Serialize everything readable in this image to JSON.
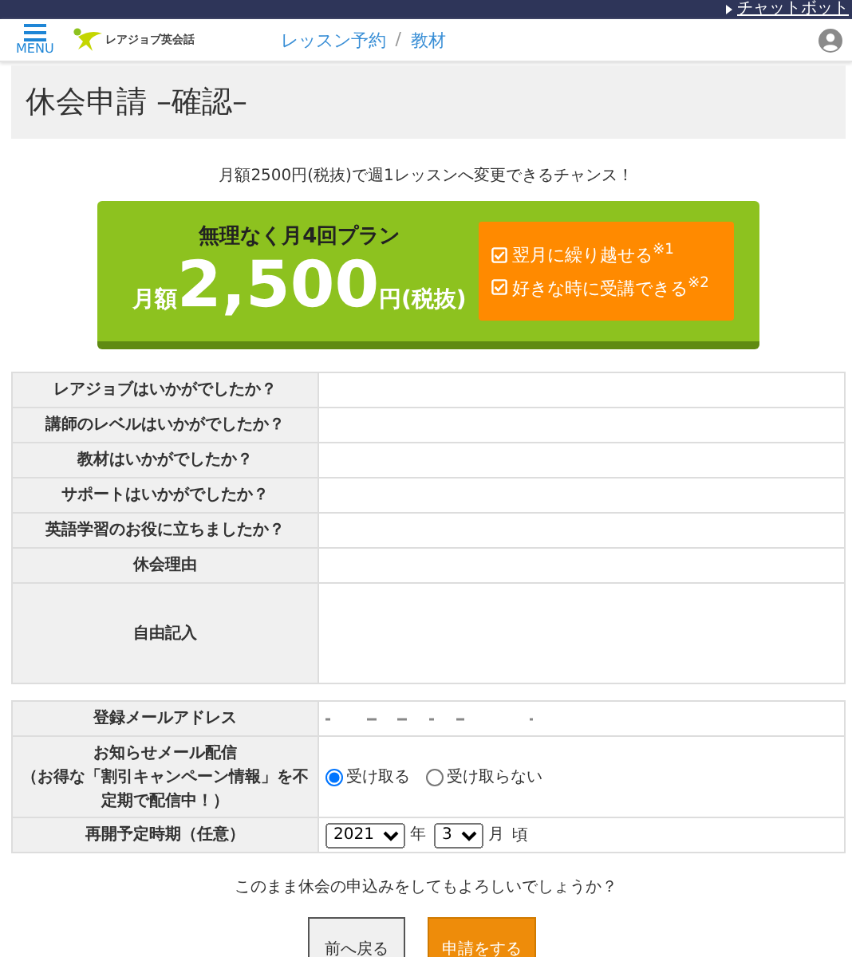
{
  "top_bar": {
    "link": "チャットボット"
  },
  "header": {
    "menu_label": "MENU",
    "logo_text": "レアジョブ英会話",
    "nav": [
      {
        "label": "レッスン予約"
      },
      {
        "label": "教材"
      }
    ],
    "separator": "/"
  },
  "page_title": "休会申請 –確認–",
  "promo": {
    "lead": "月額2500円(税抜)で週1レッスンへ変更できるチャンス！",
    "plan": "無理なく月4回プラン",
    "price_prefix": "月額",
    "price": "2,500",
    "price_suffix": "円(税抜)",
    "features": [
      {
        "text": "翌月に繰り越せる$^{※1}$",
        "checked": true
      },
      {
        "text": "好きな時に受講できる$^{※2}$",
        "checked": true
      }
    ]
  },
  "survey_table": {
    "rows": [
      {
        "label": "レアジョブはいかがでしたか？",
        "kind": "short"
      },
      {
        "label": "講師のレベルはいかがでしたか？",
        "kind": "short"
      },
      {
        "label": "教材はいかがでしたか？",
        "kind": "short"
      },
      {
        "label": "サポートはいかがでしたか？",
        "kind": "short"
      },
      {
        "label": "英語学習のお役に立ちましたか？",
        "kind": "short"
      },
      {
        "label": "休会理由",
        "kind": "short"
      },
      {
        "label": "自由記入",
        "kind": "tall"
      }
    ]
  },
  "account_table": {
    "email_label": "登録メールアドレス",
    "newsletter_label": "お知らせメール配信",
    "newsletter_note": "（お得な「割引キャンペーン情報」を不定期で配信中！）",
    "newsletter_options": [
      {
        "label": "受け取る",
        "selected": true
      },
      {
        "label": "受け取らない",
        "selected": false
      }
    ],
    "resume_label": "再開予定時期（任意）",
    "year": "2021",
    "year_unit": "年",
    "month": "3",
    "month_unit": "月",
    "suffix": "頃"
  },
  "confirm_text": "このまま休会の申込みをしてもよろしいでしょうか？",
  "buttons": [
    {
      "label": "前へ戻る",
      "kind": "secondary"
    },
    {
      "label": "申請をする",
      "kind": "primary"
    }
  ]
}
